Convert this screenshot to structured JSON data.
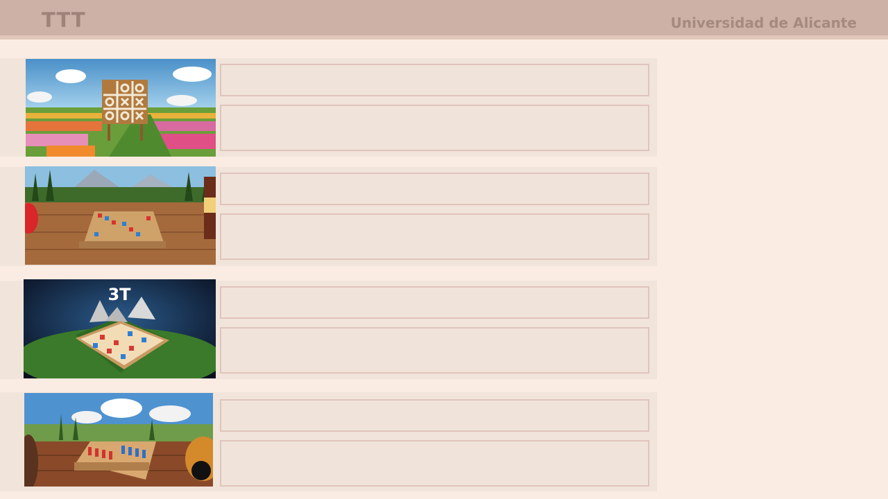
{
  "header": {
    "app_title": "TTT",
    "organization": "Universidad de Alicante",
    "background_color": "#cdb1a6"
  },
  "games": [
    {
      "image_icon": "tic-tac-toe-billboard-meadow",
      "thumbnail_text": "",
      "title": "",
      "description": ""
    },
    {
      "image_icon": "tic-tac-toe-board-on-table",
      "thumbnail_text": "",
      "title": "",
      "description": ""
    },
    {
      "image_icon": "3t-board-on-green-island",
      "thumbnail_text": "3T",
      "title": "",
      "description": ""
    },
    {
      "image_icon": "pawn-game-board-on-terrace",
      "thumbnail_text": "",
      "title": "",
      "description": ""
    }
  ],
  "colors": {
    "page_background": "#faece2",
    "card_background": "#f1e4da",
    "field_border": "#dfc4bb"
  }
}
